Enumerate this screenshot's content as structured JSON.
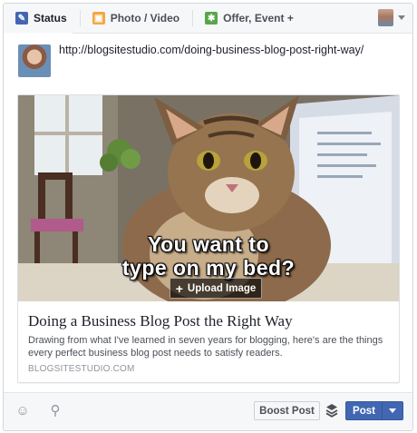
{
  "tabs": [
    {
      "label": "Status",
      "icon": "pencil-icon",
      "active": true
    },
    {
      "label": "Photo / Video",
      "icon": "photo-icon",
      "active": false
    },
    {
      "label": "Offer, Event +",
      "icon": "offer-icon",
      "active": false
    }
  ],
  "post": {
    "text": "http://blogsitestudio.com/doing-business-blog-post-right-way/"
  },
  "link_preview": {
    "image_caption_line1": "You want to",
    "image_caption_line2": "type on my bed?",
    "upload_button_label": "Upload Image",
    "title": "Doing a Business Blog Post the Right Way",
    "description": "Drawing from what I've learned in seven years for blogging, here's are the things every perfect business blog post needs to satisfy readers.",
    "domain": "BLOGSITESTUDIO.COM"
  },
  "footer": {
    "boost_label": "Boost Post",
    "post_label": "Post"
  },
  "colors": {
    "primary_button": "#4267b2",
    "tab_background": "#f6f7f9"
  }
}
